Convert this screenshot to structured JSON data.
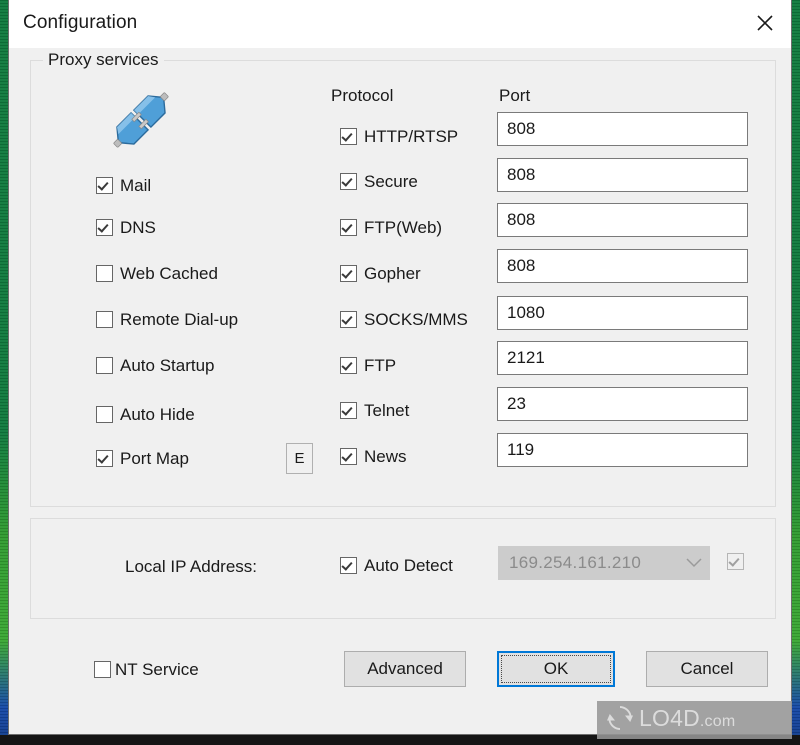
{
  "window": {
    "title": "Configuration",
    "close_icon": "close-icon"
  },
  "groups": {
    "proxy_services": {
      "legend": "Proxy services"
    },
    "local_ip": {
      "legend": ""
    }
  },
  "headers": {
    "protocol": "Protocol",
    "port": "Port"
  },
  "icons": {
    "plug": "plug-connector-icon"
  },
  "services": [
    {
      "label": "Mail",
      "checked": true
    },
    {
      "label": "DNS",
      "checked": true
    },
    {
      "label": "Web Cached",
      "checked": false
    },
    {
      "label": "Remote Dial-up",
      "checked": false
    },
    {
      "label": "Auto Startup",
      "checked": false
    },
    {
      "label": "Auto Hide",
      "checked": false
    },
    {
      "label": "Port Map",
      "checked": true
    }
  ],
  "edit_button": {
    "label": "E"
  },
  "protocols": [
    {
      "label": "HTTP/RTSP",
      "checked": true,
      "port": "808"
    },
    {
      "label": "Secure",
      "checked": true,
      "port": "808"
    },
    {
      "label": "FTP(Web)",
      "checked": true,
      "port": "808"
    },
    {
      "label": "Gopher",
      "checked": true,
      "port": "808"
    },
    {
      "label": "SOCKS/MMS",
      "checked": true,
      "port": "1080"
    },
    {
      "label": "FTP",
      "checked": true,
      "port": "2121"
    },
    {
      "label": "Telnet",
      "checked": true,
      "port": "23"
    },
    {
      "label": "News",
      "checked": true,
      "port": "119"
    }
  ],
  "local_ip": {
    "label": "Local IP Address:",
    "auto_detect": {
      "label": "Auto Detect",
      "checked": true
    },
    "address_value": "169.254.161.210",
    "address_disabled": true,
    "extra_checkbox": {
      "checked": true,
      "disabled": true
    }
  },
  "footer": {
    "nt_service": {
      "label": "NT Service",
      "checked": false
    },
    "advanced_label": "Advanced",
    "ok_label": "OK",
    "cancel_label": "Cancel",
    "default_button": "OK"
  },
  "watermark": {
    "text": "LO4D",
    "suffix": ".com"
  },
  "colors": {
    "dialog_background": "#f0f0f0",
    "titlebar": "#ffffff",
    "focus_accent": "#0078d7",
    "field_border": "#7a7a7a",
    "disabled_field": "#cccccc",
    "text": "#1a1a1a",
    "desktop_green": "#0f7a3d"
  }
}
